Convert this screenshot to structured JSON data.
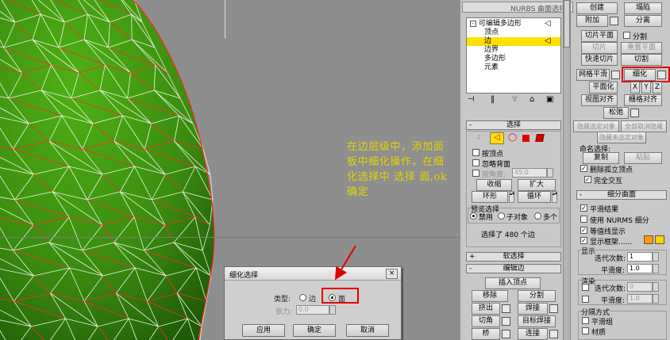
{
  "note": "在边层级中，添加面板中细化操作，在细化选择中 选择 面,ok确定",
  "colors": {
    "mesh_fill": "#3d8f10",
    "mesh_wire_white": "#e8f5e0",
    "mesh_wire_red": "#ff2a2a",
    "note_text": "#e3d400",
    "highlight": "#e00000",
    "selected_row": "#ffe100"
  },
  "dialog": {
    "title": "细化选择",
    "close": "×",
    "type_label": "类型:",
    "option_edge": "边",
    "option_face": "面",
    "selected_option": "面",
    "tension_label": "张力:",
    "tension_value": "0.0",
    "buttons": {
      "apply": "应用",
      "ok": "确定",
      "cancel": "取消"
    }
  },
  "viewport_label": "NURBS 曲面选择",
  "stack": {
    "root": "可编辑多边形",
    "items": [
      "顶点",
      "边",
      "边界",
      "多边形",
      "元素"
    ],
    "selected": "边"
  },
  "stack_toolbar_icons": [
    "pin-stack-icon",
    "show-end-result-icon",
    "make-unique-icon",
    "remove-modifier-icon",
    "configure-modifier-sets-icon"
  ],
  "edit_geometry": {
    "create": "创建",
    "collapse": "塌陷",
    "attach": "附加",
    "detach": "分离",
    "slice_plane": "切片平面",
    "split": "分割",
    "slice": "切片",
    "reset_plane": "重置平面",
    "quickslice": "快速切片",
    "cut": "切割",
    "meshsmooth": "网格平滑",
    "tessellate": "细化",
    "planarize": "平面化",
    "x": "X",
    "y": "Y",
    "z": "Z",
    "view_align": "视图对齐",
    "grid_align": "栅格对齐",
    "relax": "松弛",
    "hide_selected": "隐藏选定对象",
    "unhide_all": "全部取消隐藏",
    "hide_unselected": "隐藏未选定对象",
    "named_selections": "命名选择:",
    "copy": "复制",
    "paste": "粘贴",
    "delete_isolated": "删除孤立顶点",
    "full_interactivity": "完全交互"
  },
  "subdivision": {
    "title": "细分曲面",
    "smooth_result": "平滑结果",
    "use_nurms": "使用 NURMS 细分",
    "isoline_display": "等值线显示",
    "show_cage": "显示框架......",
    "cage_color_1": "#ff9a00",
    "cage_color_2": "#ffd400",
    "display_label": "显示",
    "iterations": "迭代次数:",
    "iterations_value": "1",
    "smoothness": "平滑度:",
    "smoothness_value": "1.0",
    "render_label": "渲染",
    "render_iterations_value": "0",
    "render_smoothness_value": "1.0",
    "separate_by": "分隔方式",
    "smoothing_groups": "平滑组",
    "materials": "材质"
  },
  "selection": {
    "title": "选择",
    "by_vertex": "按顶点",
    "ignore_backfacing": "忽略背面",
    "by_angle": "按角度:",
    "by_angle_value": "45.0",
    "shrink": "收缩",
    "grow": "扩大",
    "ring": "环形",
    "loop": "循环",
    "preview_title": "预览选择",
    "preview_off": "禁用",
    "preview_subobj": "子对象",
    "preview_multi": "多个",
    "status": "选择了 480 个边"
  },
  "soft_selection": {
    "title": "软选择"
  },
  "edit_edges": {
    "title": "编辑边",
    "insert_vertex": "插入顶点",
    "remove": "移除",
    "split": "分割",
    "extrude": "挤出",
    "weld": "焊接",
    "chamfer": "切角",
    "target_weld": "目标焊接",
    "bridge": "桥",
    "connect": "连接"
  }
}
